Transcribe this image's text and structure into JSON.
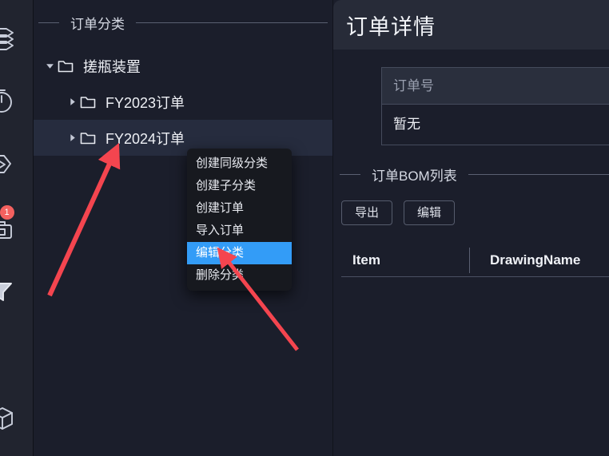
{
  "rail": {
    "items": [
      {
        "name": "layers-icon",
        "badge": null
      },
      {
        "name": "timer-icon",
        "badge": null
      },
      {
        "name": "share-icon",
        "badge": null
      },
      {
        "name": "toolbox-icon",
        "badge": "1"
      },
      {
        "name": "funnel-icon",
        "badge": null
      },
      {
        "name": "signal-icon",
        "badge": null
      },
      {
        "name": "cube-icon",
        "badge": null
      }
    ]
  },
  "tree_panel": {
    "header_title": "订单分类",
    "nodes": [
      {
        "label": "搓瓶装置",
        "level": 1,
        "expanded": true,
        "selected": false
      },
      {
        "label": "FY2023订单",
        "level": 2,
        "expanded": false,
        "selected": false
      },
      {
        "label": "FY2024订单",
        "level": 2,
        "expanded": false,
        "selected": true
      }
    ]
  },
  "context_menu": {
    "items": [
      {
        "label": "创建同级分类",
        "active": false
      },
      {
        "label": "创建子分类",
        "active": false
      },
      {
        "label": "创建订单",
        "active": false
      },
      {
        "label": "导入订单",
        "active": false
      },
      {
        "label": "编辑分类",
        "active": true
      },
      {
        "label": "删除分类",
        "active": false
      }
    ]
  },
  "detail_panel": {
    "title": "订单详情",
    "order_table": {
      "header": "订单号",
      "value": "暂无"
    },
    "bom_section": {
      "title": "订单BOM列表",
      "buttons": [
        {
          "label": "导出"
        },
        {
          "label": "编辑"
        }
      ],
      "columns": [
        "Item",
        "DrawingName"
      ],
      "rows": []
    }
  },
  "colors": {
    "background": "#1b1e2b",
    "rail_background": "#21242f",
    "selected_row": "#262c3e",
    "menu_background": "#17191f",
    "menu_highlight": "#339cf7",
    "badge": "#f4615f",
    "annotation_arrow": "#f4454f",
    "header_bar": "#272b38"
  }
}
